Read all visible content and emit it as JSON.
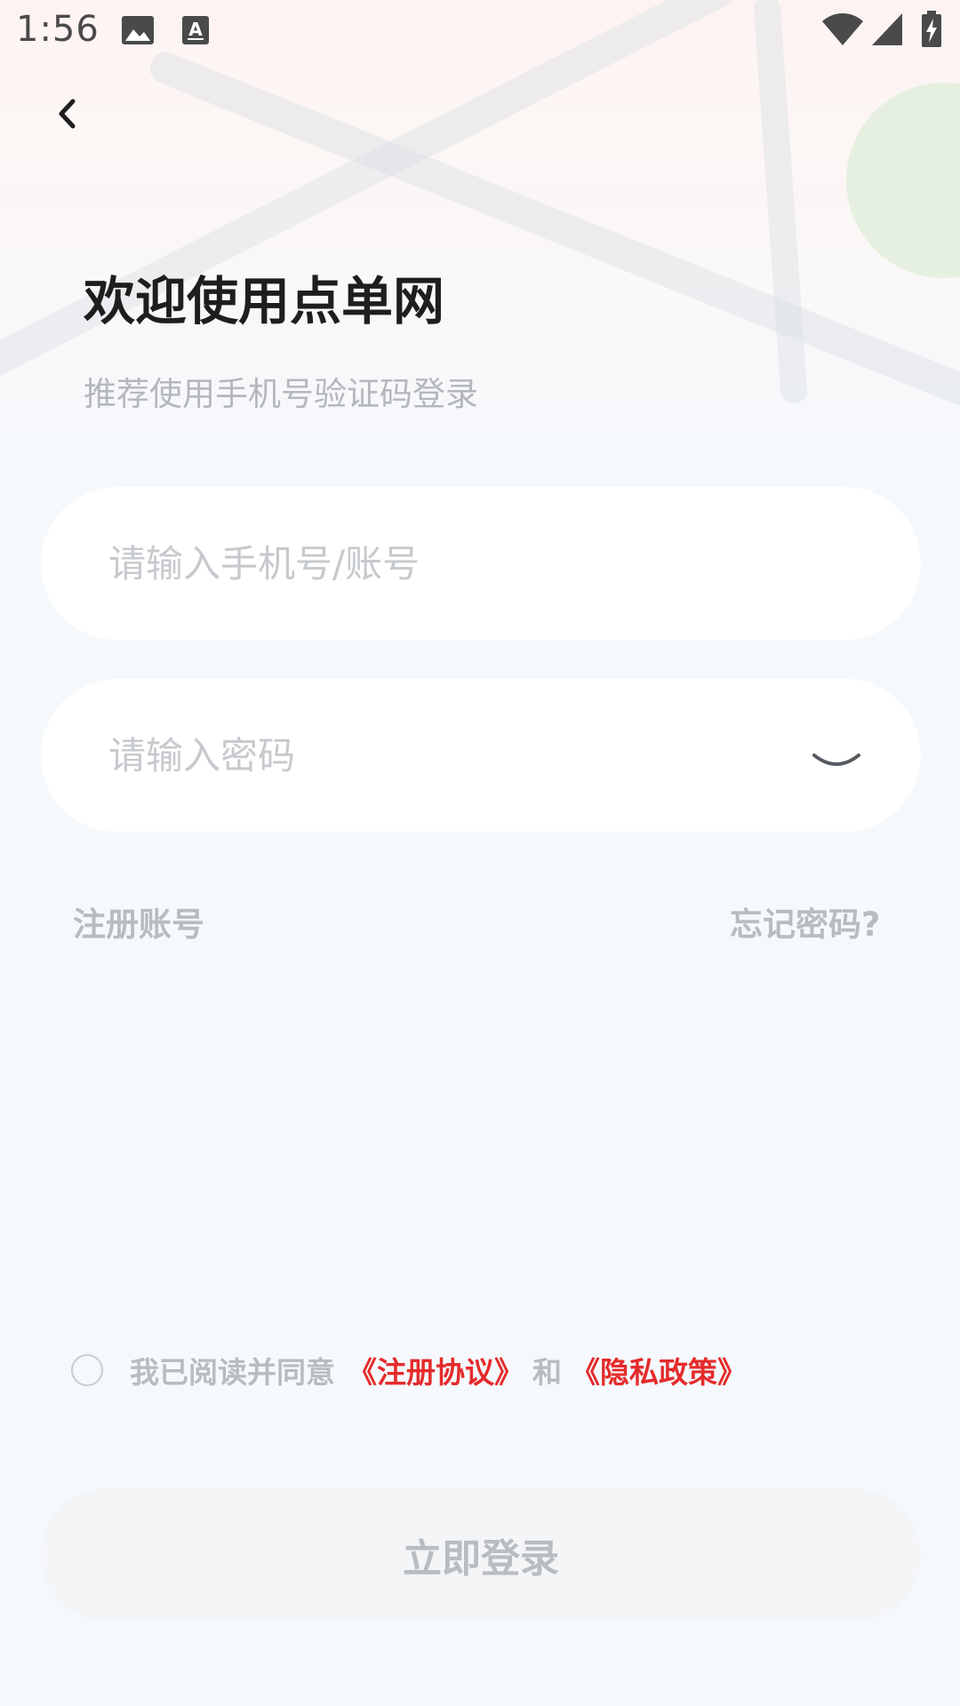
{
  "status_bar": {
    "time": "1:56",
    "icons": [
      "image-icon",
      "text-a-icon",
      "wifi-icon",
      "signal-icon",
      "battery-icon"
    ]
  },
  "header": {
    "back_icon": "chevron-left-icon"
  },
  "welcome": {
    "title": "欢迎使用点单网",
    "subtitle": "推荐使用手机号验证码登录"
  },
  "form": {
    "account_placeholder": "请输入手机号/账号",
    "password_placeholder": "请输入密码",
    "password_toggle_icon": "eye-closed-icon"
  },
  "links": {
    "register": "注册账号",
    "forgot": "忘记密码?"
  },
  "agreement": {
    "checked": false,
    "prefix": "我已阅读并同意",
    "terms": "《注册协议》",
    "and": "和",
    "privacy": "《隐私政策》"
  },
  "login_button": {
    "label": "立即登录"
  },
  "colors": {
    "link_red": "#e52b2b",
    "muted_text": "#b8bbbf",
    "title_text": "#1e1e1e",
    "field_bg": "#ffffff",
    "button_bg": "#f3f5f7"
  }
}
